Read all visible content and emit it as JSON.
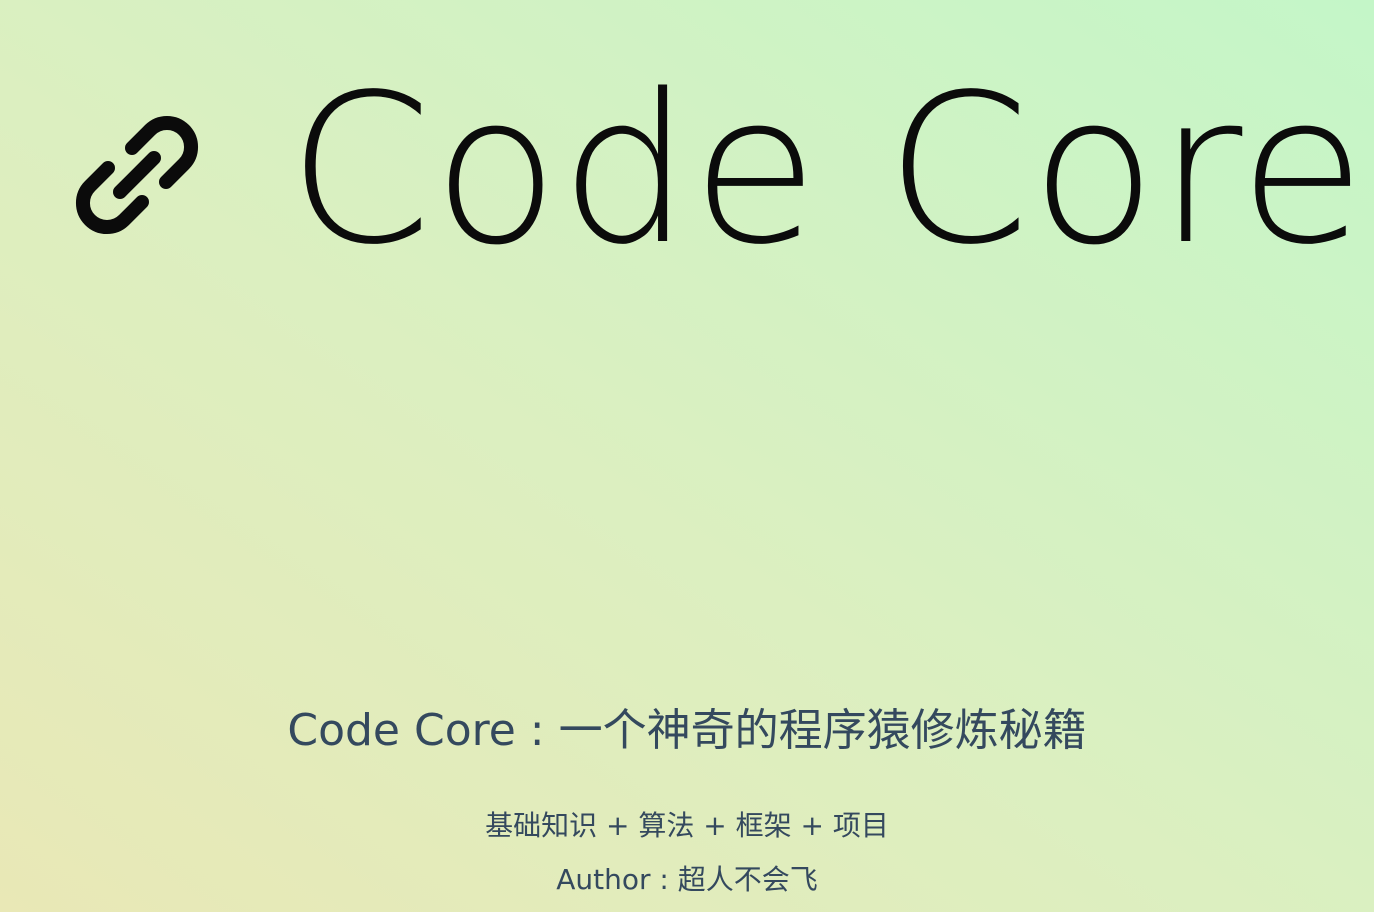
{
  "cover": {
    "title": "Code Core",
    "anchor_icon": "link-icon",
    "tagline": "Code Core : 一个神奇的程序猿修炼秘籍",
    "topics": "基础知识 + 算法 + 框架 + 项目",
    "author": "Author : 超人不会飞"
  },
  "colors": {
    "title": "#0b0b0b",
    "text": "#34495e",
    "background_start": "#e9e8b6",
    "background_end": "#c4f6c8"
  }
}
